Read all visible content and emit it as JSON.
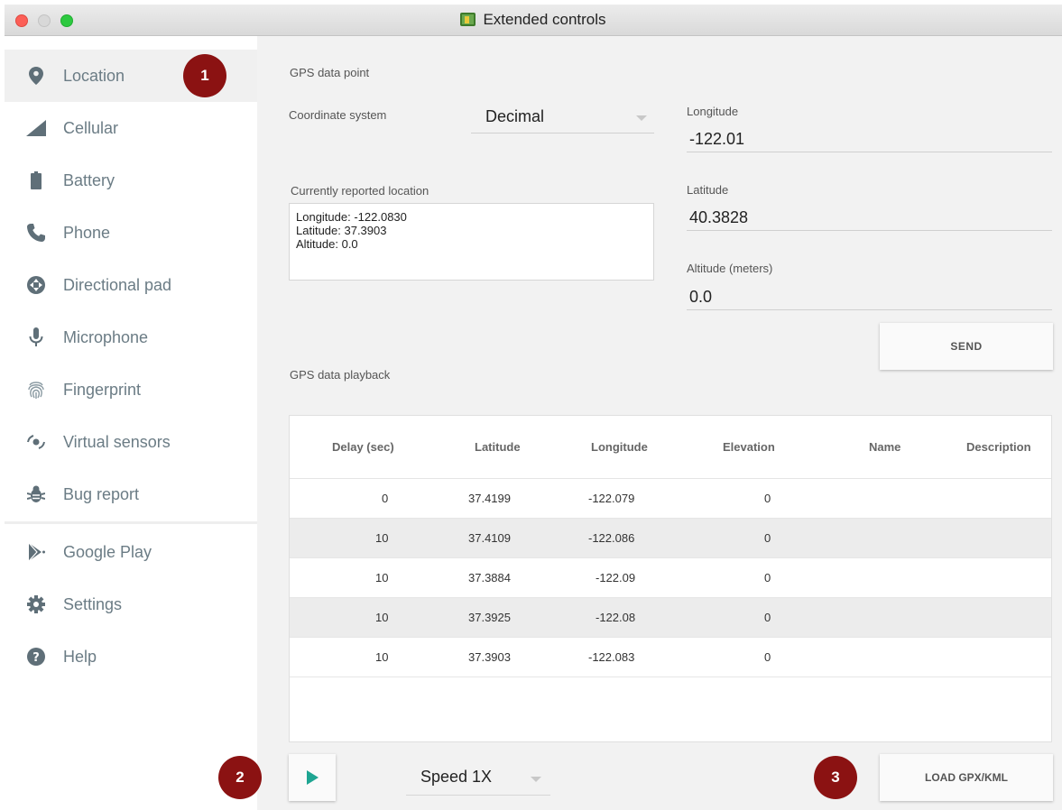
{
  "window": {
    "title": "Extended controls"
  },
  "sidebar": {
    "items": [
      {
        "label": "Location",
        "icon": "location-pin-icon"
      },
      {
        "label": "Cellular",
        "icon": "cellular-signal-icon"
      },
      {
        "label": "Battery",
        "icon": "battery-icon"
      },
      {
        "label": "Phone",
        "icon": "phone-icon"
      },
      {
        "label": "Directional pad",
        "icon": "dpad-icon"
      },
      {
        "label": "Microphone",
        "icon": "microphone-icon"
      },
      {
        "label": "Fingerprint",
        "icon": "fingerprint-icon"
      },
      {
        "label": "Virtual sensors",
        "icon": "virtual-sensors-icon"
      },
      {
        "label": "Bug report",
        "icon": "bug-icon"
      },
      {
        "label": "Google Play",
        "icon": "google-play-icon"
      },
      {
        "label": "Settings",
        "icon": "gear-icon"
      },
      {
        "label": "Help",
        "icon": "help-icon"
      }
    ],
    "active_index": 0
  },
  "gps_point": {
    "section_title": "GPS data point",
    "coordinate_system_label": "Coordinate system",
    "coordinate_system_value": "Decimal",
    "current_location_label": "Currently reported location",
    "current_location_lines": [
      "Longitude: -122.0830",
      "Latitude: 37.3903",
      "Altitude: 0.0"
    ],
    "longitude_label": "Longitude",
    "longitude_value": "-122.01",
    "latitude_label": "Latitude",
    "latitude_value": "40.3828",
    "altitude_label": "Altitude (meters)",
    "altitude_value": "0.0",
    "send_label": "SEND"
  },
  "playback": {
    "section_title": "GPS data playback",
    "columns": [
      "Delay (sec)",
      "Latitude",
      "Longitude",
      "Elevation",
      "Name",
      "Description"
    ],
    "rows": [
      [
        "0",
        "37.4199",
        "-122.079",
        "0",
        "",
        ""
      ],
      [
        "10",
        "37.4109",
        "-122.086",
        "0",
        "",
        ""
      ],
      [
        "10",
        "37.3884",
        "-122.09",
        "0",
        "",
        ""
      ],
      [
        "10",
        "37.3925",
        "-122.08",
        "0",
        "",
        ""
      ],
      [
        "10",
        "37.3903",
        "-122.083",
        "0",
        "",
        ""
      ]
    ],
    "speed_value": "Speed 1X",
    "load_label": "LOAD GPX/KML"
  },
  "callouts": [
    "1",
    "2",
    "3"
  ],
  "colors": {
    "accent_play": "#1ea592",
    "callout": "#8b1212",
    "sidebar_text": "#6b7c85"
  }
}
